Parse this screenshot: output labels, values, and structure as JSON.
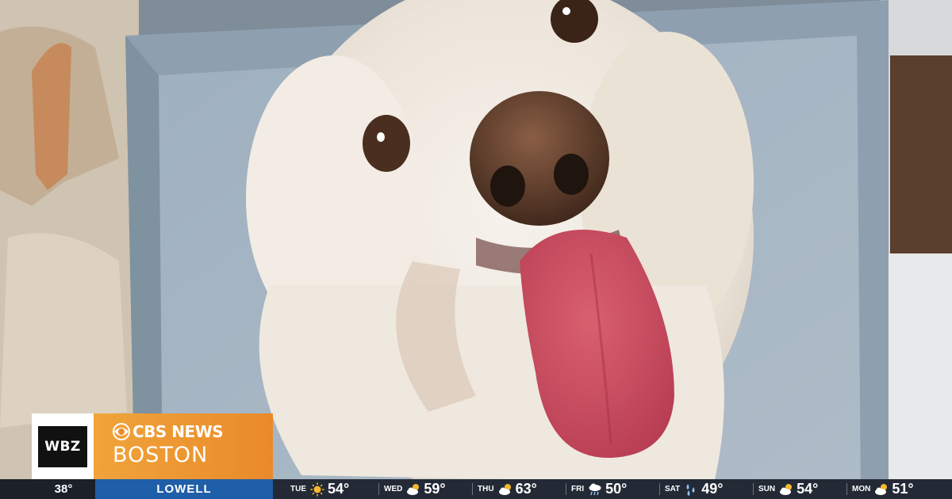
{
  "scene": {
    "subject": "white dog photo print",
    "colors": {
      "background_wall": "#8a97a4",
      "print_background": "#a7b4c0",
      "dog_fur": "#efe9e2",
      "tongue": "#c8485d",
      "nose": "#5a3a2b"
    }
  },
  "branding": {
    "station_logo_text": "WBZ",
    "network_text": "CBS NEWS",
    "city_text": "BOSTON",
    "accent_color": "#f0a43a"
  },
  "ticker": {
    "current_temp": "38°",
    "location": "LOWELL",
    "forecast": [
      {
        "day": "TUE",
        "icon": "sun-icon",
        "temp": "54°"
      },
      {
        "day": "WED",
        "icon": "partly-cloudy-icon",
        "temp": "59°"
      },
      {
        "day": "THU",
        "icon": "partly-cloudy-icon",
        "temp": "63°"
      },
      {
        "day": "FRI",
        "icon": "rain-cloud-icon",
        "temp": "50°"
      },
      {
        "day": "SAT",
        "icon": "rain-drops-icon",
        "temp": "49°"
      },
      {
        "day": "SUN",
        "icon": "partly-cloudy-icon",
        "temp": "54°"
      },
      {
        "day": "MON",
        "icon": "partly-cloudy-icon",
        "temp": "51°"
      }
    ]
  }
}
